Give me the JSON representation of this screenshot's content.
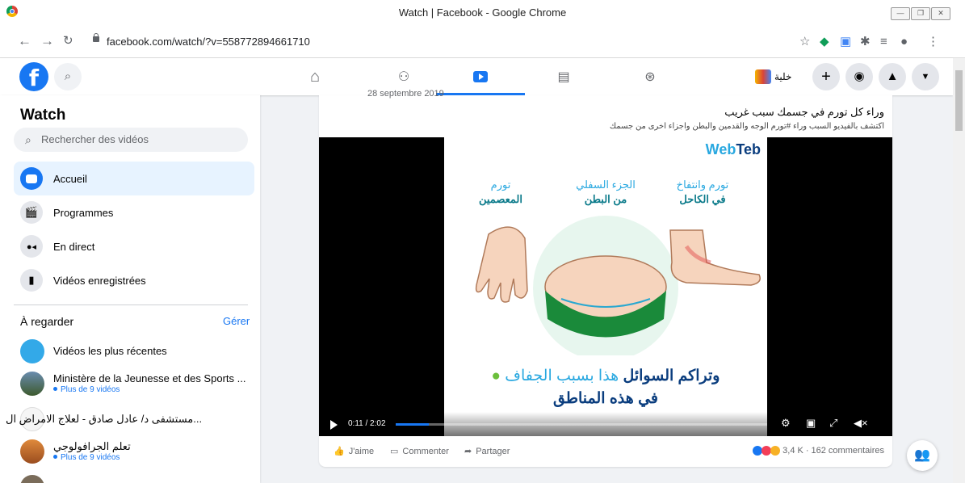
{
  "window": {
    "title": "Watch | Facebook - Google Chrome"
  },
  "browser": {
    "url": "facebook.com/watch/?v=558772894661710"
  },
  "header": {
    "group_name": "خلية"
  },
  "sidebar": {
    "title": "Watch",
    "search_placeholder": "Rechercher des vidéos",
    "items": [
      {
        "label": "Accueil",
        "active": true
      },
      {
        "label": "Programmes"
      },
      {
        "label": "En direct"
      },
      {
        "label": "Vidéos enregistrées"
      }
    ],
    "section_title": "À regarder",
    "manage_label": "Gérer",
    "watchlist": [
      {
        "name": "Vidéos les plus récentes",
        "sub": ""
      },
      {
        "name": "Ministère de la Jeunesse et des Sports ...",
        "sub": "Plus de 9 vidéos"
      },
      {
        "name": "مستشفى د/ عادل صادق - لعلاج الامراض ال...",
        "sub": ""
      },
      {
        "name": "تعلم الجرافولوجي",
        "sub": "Plus de 9 vidéos"
      }
    ]
  },
  "post": {
    "date": "28 septembre 2019",
    "title": "وراء كل تورم في جسمك سبب غريب",
    "description": "اكتشف بالفيديو السبب وراء #تورم الوجه والقدمين والبطن واجزاء اخرى من جسمك",
    "video": {
      "brand_a": "Web",
      "brand_b": "Teb",
      "label_right_1": "تورم وانتفاخ",
      "label_right_2": "في الكاحل",
      "label_mid_1": "الجزء السفلي",
      "label_mid_2": "من البطن",
      "label_left_1": "تورم",
      "label_left_2": "المعصمين",
      "caption_light": "هذا بسبب الجفاف",
      "caption_bold": "وتراكم السوائل",
      "caption_line2": "في هذه المناطق",
      "time": "0:11 / 2:02",
      "progress": 0.09
    },
    "actions": {
      "like": "J'aime",
      "comment": "Commenter",
      "share": "Partager"
    },
    "reactions": {
      "count": "3,4 K",
      "comments": "162 commentaires",
      "separator": "·"
    }
  }
}
